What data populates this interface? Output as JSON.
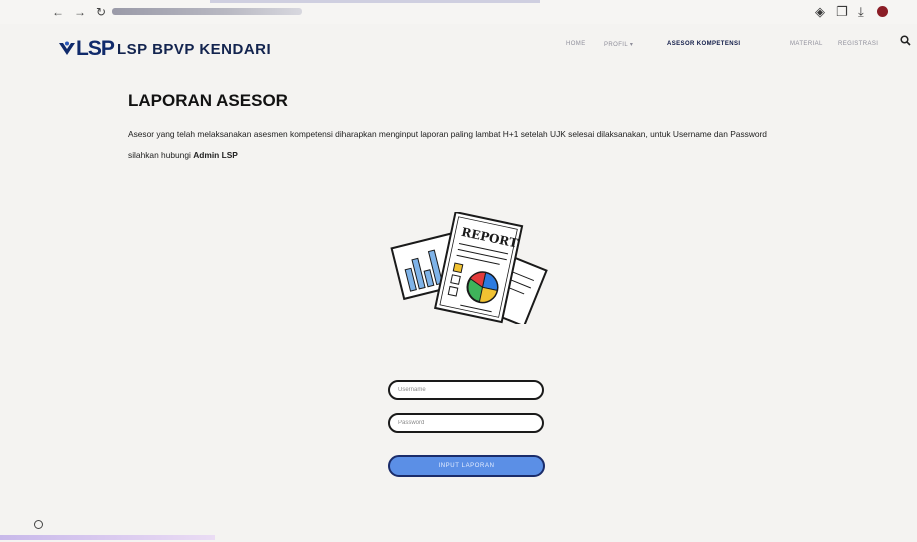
{
  "browser": {
    "back": "←",
    "forward": "→",
    "reload": "↻",
    "toolbar_icons": [
      "extension-icon",
      "tab-icon",
      "download-icon",
      "profile-icon"
    ]
  },
  "site": {
    "logo": "LSP",
    "name": "LSP BPVP KENDARI",
    "menu": [
      {
        "label": "HOME",
        "active": false
      },
      {
        "label": "PROFIL ▾",
        "active": false
      },
      {
        "label": "ASESOR KOMPETENSI",
        "active": true
      },
      {
        "label": "MATERIAL",
        "active": false
      },
      {
        "label": "REGISTRASI",
        "active": false
      }
    ]
  },
  "page": {
    "title": "LAPORAN ASESOR",
    "desc_text": "Asesor yang telah melaksanakan asesmen kompetensi diharapkan menginput laporan paling lambat H+1 setelah UJK selesai dilaksanakan, untuk Username dan Password silahkan hubungi ",
    "desc_strong": "Admin LSP"
  },
  "illustration": {
    "report_label": "REPORT"
  },
  "form": {
    "username_placeholder": "Username",
    "password_placeholder": "Password",
    "submit_label": "INPUT LAPORAN"
  },
  "colors": {
    "brand": "#102a6b",
    "button": "#5b8fe6",
    "button_border": "#1a2c6a",
    "pie": [
      "#e23b3b",
      "#2d7be0",
      "#3fb35a",
      "#f1c232"
    ]
  }
}
